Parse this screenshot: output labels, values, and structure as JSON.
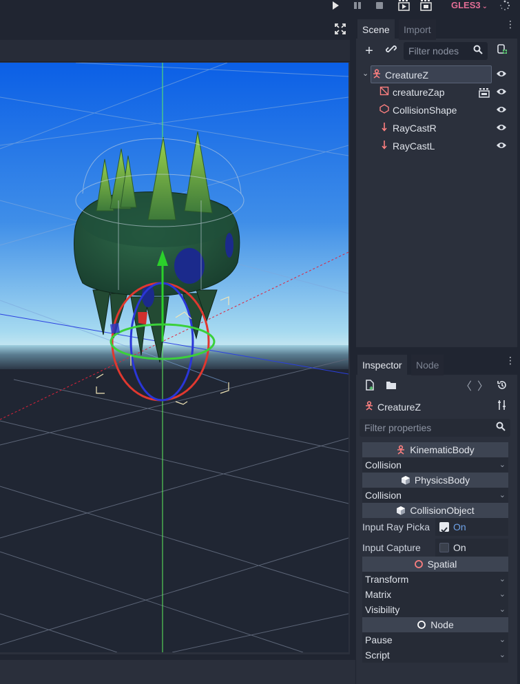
{
  "toolbar": {
    "play_icon": "play-icon",
    "pause_icon": "pause-icon",
    "stop_icon": "stop-icon",
    "play_scene_icon": "play-scene-icon",
    "play_custom_icon": "play-custom-scene-icon",
    "renderer": "GLES3",
    "renderer_dropdown_icon": "chevron-down-icon",
    "spinner_icon": "update-spinner-icon"
  },
  "scene_dock": {
    "tabs": [
      "Scene",
      "Import"
    ],
    "active_tab": "Scene",
    "filter_placeholder": "Filter nodes",
    "tree": [
      {
        "name": "CreatureZ",
        "type": "KinematicBody",
        "selected": true
      },
      {
        "name": "creatureZap",
        "type": "MeshInstance",
        "has_scene_icon": true
      },
      {
        "name": "CollisionShape",
        "type": "CollisionShape"
      },
      {
        "name": "RayCastR",
        "type": "RayCast"
      },
      {
        "name": "RayCastL",
        "type": "RayCast"
      }
    ]
  },
  "inspector_dock": {
    "tabs": [
      "Inspector",
      "Node"
    ],
    "active_tab": "Inspector",
    "object_name": "CreatureZ",
    "filter_placeholder": "Filter properties",
    "sections": {
      "kinematic": "KinematicBody",
      "kinematic_group": "Collision",
      "physics": "PhysicsBody",
      "physics_group": "Collision",
      "collision_object": "CollisionObject",
      "spatial": "Spatial",
      "node": "Node"
    },
    "props": {
      "input_ray_label": "Input Ray Picka",
      "input_ray_value": "On",
      "input_capture_label": "Input Capture",
      "input_capture_value": "On"
    },
    "spatial_groups": [
      "Transform",
      "Matrix",
      "Visibility"
    ],
    "node_groups": [
      "Pause",
      "Script"
    ]
  },
  "colors": {
    "accent": "#6fa2e8",
    "renderer": "#e36d95",
    "node_red": "#fc7f7f",
    "sky_top": "#0b63e8",
    "sky_horizon": "#a6daf0",
    "ground": "#202633"
  }
}
